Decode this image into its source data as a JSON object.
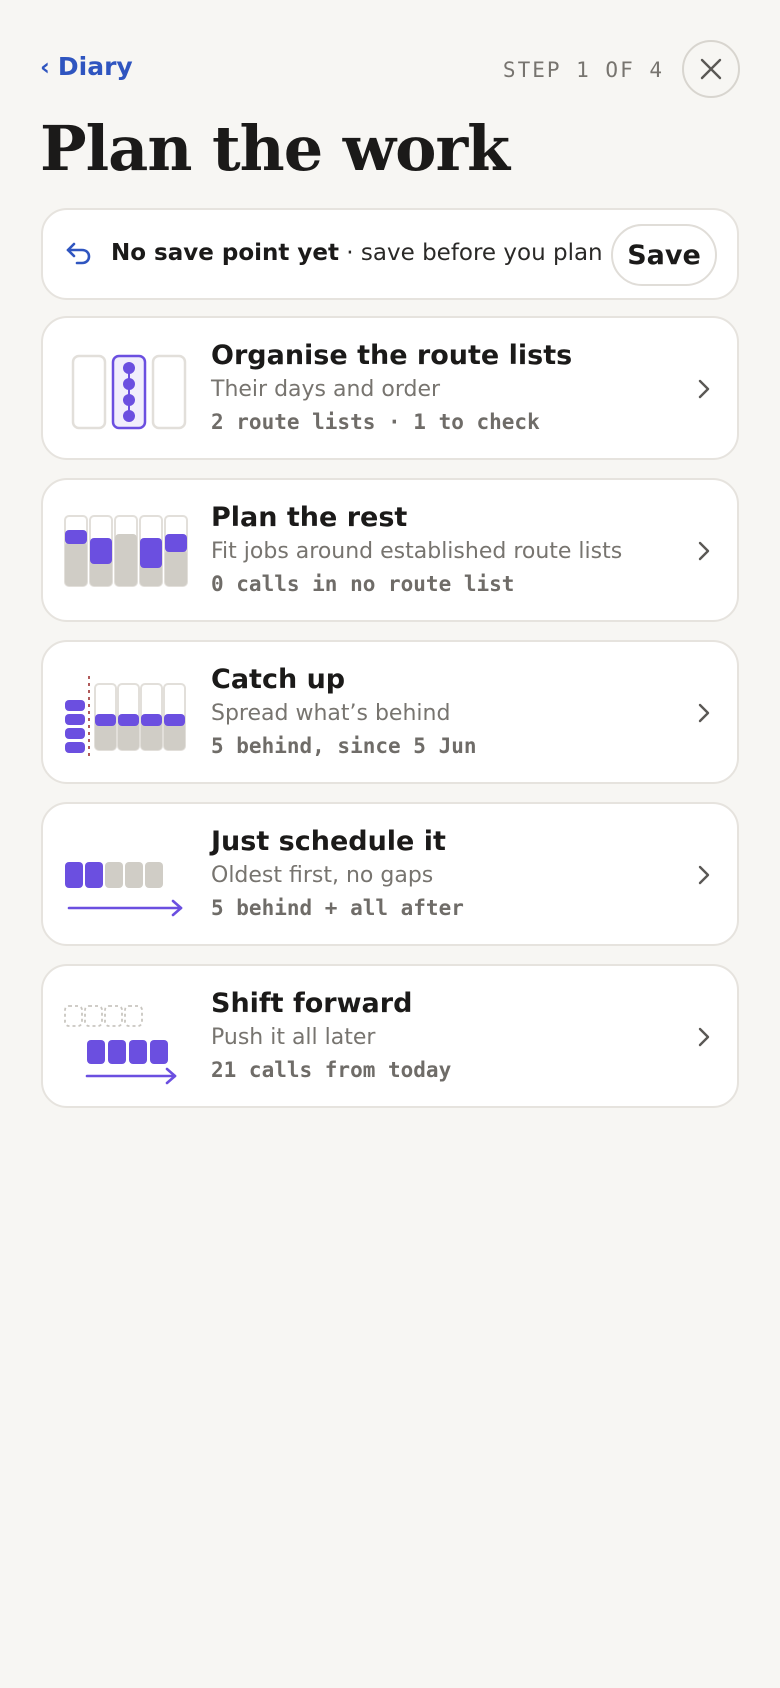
{
  "header": {
    "back_label": "Diary",
    "step": "STEP 1 OF 4",
    "title": "Plan the work"
  },
  "save_bar": {
    "status_bold": "No save point yet",
    "status_rest": " · save before you plan",
    "save_label": "Save"
  },
  "options": [
    {
      "title": "Organise the route lists",
      "subtitle": "Their days and order",
      "meta": "2 route lists · 1 to check",
      "icon": "route-lists-icon"
    },
    {
      "title": "Plan the rest",
      "subtitle": "Fit jobs around established route lists",
      "meta": "0 calls in no route list",
      "icon": "plan-rest-icon"
    },
    {
      "title": "Catch up",
      "subtitle": "Spread what’s behind",
      "meta": "5 behind, since 5 Jun",
      "icon": "catch-up-icon"
    },
    {
      "title": "Just schedule it",
      "subtitle": "Oldest first, no gaps",
      "meta": "5 behind + all after",
      "icon": "schedule-icon"
    },
    {
      "title": "Shift forward",
      "subtitle": "Push it all later",
      "meta": "21 calls from today",
      "icon": "shift-forward-icon"
    }
  ],
  "colors": {
    "accent": "#6b4fe0",
    "link": "#2f55c0",
    "muted_fill": "#d0cdc6",
    "background": "#f7f6f3"
  }
}
